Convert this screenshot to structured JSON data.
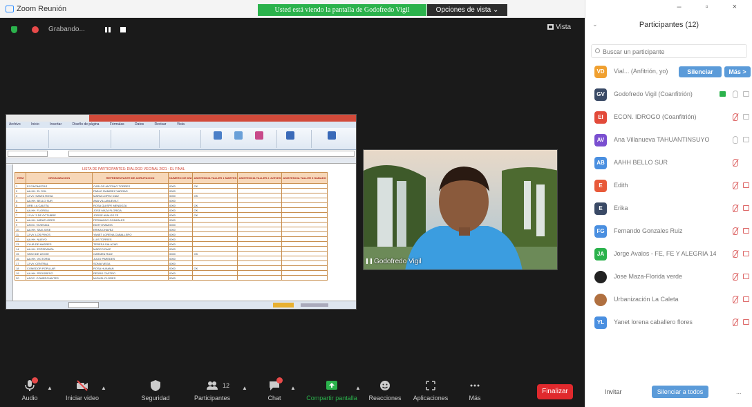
{
  "window": {
    "title": "Zoom Reunión",
    "share_banner": "Usted está viendo la pantalla de Godofredo Vigil",
    "view_options": "Opciones de vista ⌄",
    "controls": "–  ▫  ×"
  },
  "meeting": {
    "recording_label": "Grabando...",
    "view_label": "Vista",
    "speaker_name": "Godofredo Vigil"
  },
  "spreadsheet": {
    "title": "LISTA DE PARTICIPANTES: DIALOGO VECINAL 2021 - EL FINAL",
    "tabs": [
      "Archivo",
      "Inicio",
      "Insertar",
      "Diseño de página",
      "Fórmulas",
      "Datos",
      "Revisar",
      "Vista"
    ],
    "headers": [
      "ITEM",
      "ORGANIZACION",
      "REPRESENTANTE DE AGRUPACION",
      "NUMERO DE DNI",
      "ASISTENCIA TALLER 1 MARTES",
      "ASISTENCIA TALLER 2 JUEVES",
      "ASISTENCIA TALLER 3 SABADO"
    ],
    "rows": [
      [
        "1",
        "ECONOMISTAS",
        "CARLOS ANTONIO TORRES",
        "0000",
        "OK",
        "",
        ""
      ],
      [
        "2",
        "AA.HH. EL SOL",
        "PABLO RAMIREZ VARGAS",
        "0000",
        "",
        "",
        ""
      ],
      [
        "3",
        "JJ.VV. SANTA ROSA",
        "MARIA LOPEZ DIAZ",
        "0000",
        "OK",
        "",
        ""
      ],
      [
        "4",
        "AA.HH. BELLO SUR",
        "ANA VILLANUEVA T.",
        "0000",
        "",
        "",
        ""
      ],
      [
        "5",
        "URB. LA CALETA",
        "ROSA QUISPE MENDOZA",
        "0000",
        "OK",
        "",
        ""
      ],
      [
        "6",
        "AA.HH. FLORIDA",
        "JOSE MAZA FLORIDA",
        "0000",
        "OK",
        "",
        ""
      ],
      [
        "7",
        "JJ.VV. 3 DE OCTUBRE",
        "JORGE AVALOS FE",
        "0000",
        "OK",
        "",
        ""
      ],
      [
        "8",
        "AA.HH. MIRAFLORES",
        "FERNANDO GONZALES",
        "0000",
        "",
        "",
        ""
      ],
      [
        "9",
        "ASOC. VIVIENDA",
        "EDITH RAMOS",
        "0000",
        "",
        "",
        ""
      ],
      [
        "10",
        "AA.HH. SAN JOSE",
        "ERIKA CHAVEZ",
        "0000",
        "",
        "",
        ""
      ],
      [
        "11",
        "JJ.VV. LOS PINOS",
        "YANET LORENA CABALLERO",
        "0000",
        "",
        "",
        ""
      ],
      [
        "12",
        "AA.HH. NUEVO",
        "LUIS TORRES",
        "0000",
        "",
        "",
        ""
      ],
      [
        "13",
        "CLUB DE MADRES",
        "TERESA SALAZAR",
        "0000",
        "",
        "",
        ""
      ],
      [
        "14",
        "AA.HH. ESPERANZA",
        "MARCO DIAZ",
        "0000",
        "",
        "",
        ""
      ],
      [
        "15",
        "VASO DE LECHE",
        "CARMEN RUIZ",
        "0000",
        "OK",
        "",
        ""
      ],
      [
        "16",
        "AA.HH. VICTORIA",
        "JULIO PAREDES",
        "0000",
        "",
        "",
        ""
      ],
      [
        "17",
        "JJ.VV. CENTRAL",
        "SONIA VEGA",
        "0000",
        "",
        "",
        ""
      ],
      [
        "18",
        "COMEDOR POPULAR",
        "ROSA HUAMAN",
        "0000",
        "OK",
        "",
        ""
      ],
      [
        "19",
        "AA.HH. PROGRESO",
        "PEDRO CASTRO",
        "0000",
        "",
        "",
        ""
      ],
      [
        "20",
        "ASOC. COMERCIANTES",
        "MIGUEL FLORES",
        "0000",
        "",
        "",
        ""
      ]
    ]
  },
  "toolbar": {
    "items": [
      {
        "label": "Audio",
        "icon": "microphone-icon"
      },
      {
        "label": "Iniciar video",
        "icon": "video-off-icon"
      },
      {
        "label": "Seguridad",
        "icon": "shield-icon"
      },
      {
        "label": "Participantes",
        "icon": "participants-icon",
        "count": "12"
      },
      {
        "label": "Chat",
        "icon": "chat-icon"
      },
      {
        "label": "Compartir pantalla",
        "icon": "share-screen-icon"
      },
      {
        "label": "Reacciones",
        "icon": "smiley-icon"
      },
      {
        "label": "Aplicaciones",
        "icon": "apps-icon"
      },
      {
        "label": "Más",
        "icon": "more-icon"
      }
    ],
    "end_label": "Finalizar"
  },
  "participants_panel": {
    "title": "Participantes (12)",
    "search_placeholder": "Buscar un participante",
    "list": [
      {
        "initials": "VD",
        "color": "#f0a030",
        "name": "Vial... (Anfitrión, yo)"
      },
      {
        "initials": "GV",
        "color": "#3a4a66",
        "name": "Godofredo Vigil (Coanfitrión)"
      },
      {
        "initials": "EI",
        "color": "#e24a3a",
        "name": "ECON. IDROGO (Coanfitrión)"
      },
      {
        "initials": "AV",
        "color": "#7a4fd0",
        "name": "Ana Villanueva TAHUANTINSUYO"
      },
      {
        "initials": "AB",
        "color": "#4a8fe0",
        "name": "AAHH BELLO SUR"
      },
      {
        "initials": "E",
        "color": "#e85a3a",
        "name": "Edith"
      },
      {
        "initials": "E",
        "color": "#3a4a66",
        "name": "Erika"
      },
      {
        "initials": "FG",
        "color": "#4a8fe0",
        "name": "Fernando Gonzales Ruiz"
      },
      {
        "initials": "JA",
        "color": "#2bb24c",
        "name": "Jorge Avalos - FE, FE Y ALEGRIA 14"
      },
      {
        "initials": "",
        "color": "#222222",
        "name": "Jose Maza-Florida verde"
      },
      {
        "initials": "",
        "color": "#b07040",
        "name": "Urbanización La Caleta"
      },
      {
        "initials": "YL",
        "color": "#4a8fe0",
        "name": "Yanet lorena caballero flores"
      }
    ],
    "silence_label": "Silenciar",
    "more_label": "Más >",
    "invite_label": "Invitar",
    "mute_all_label": "Silenciar a todos",
    "more_dots": "..."
  }
}
